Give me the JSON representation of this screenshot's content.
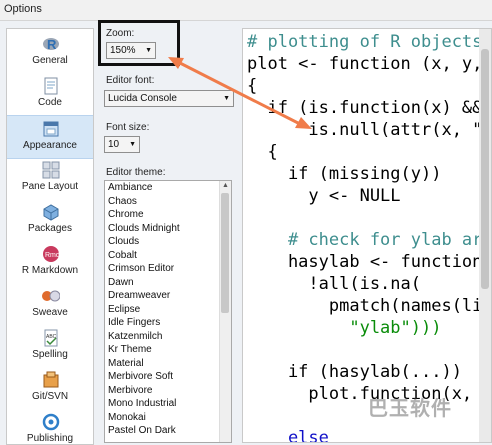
{
  "window": {
    "title": "Options"
  },
  "sidebar": {
    "items": [
      {
        "label": "General",
        "icon": "r-logo-icon",
        "selected": false
      },
      {
        "label": "Code",
        "icon": "code-document-icon",
        "selected": false
      },
      {
        "label": "Appearance",
        "icon": "appearance-icon",
        "selected": true
      },
      {
        "label": "Pane Layout",
        "icon": "pane-layout-icon",
        "selected": false
      },
      {
        "label": "Packages",
        "icon": "packages-icon",
        "selected": false
      },
      {
        "label": "R Markdown",
        "icon": "rmarkdown-icon",
        "selected": false
      },
      {
        "label": "Sweave",
        "icon": "sweave-icon",
        "selected": false
      },
      {
        "label": "Spelling",
        "icon": "spelling-icon",
        "selected": false
      },
      {
        "label": "Git/SVN",
        "icon": "git-svn-icon",
        "selected": false
      },
      {
        "label": "Publishing",
        "icon": "publishing-icon",
        "selected": false
      }
    ]
  },
  "appearance": {
    "zoom_label": "Zoom:",
    "zoom_value": "150%",
    "editor_font_label": "Editor font:",
    "editor_font_value": "Lucida Console",
    "font_size_label": "Font size:",
    "font_size_value": "10",
    "editor_theme_label": "Editor theme:",
    "themes": [
      "Ambiance",
      "Chaos",
      "Chrome",
      "Clouds Midnight",
      "Clouds",
      "Cobalt",
      "Crimson Editor",
      "Dawn",
      "Dreamweaver",
      "Eclipse",
      "Idle Fingers",
      "Katzenmilch",
      "Kr Theme",
      "Material",
      "Merbivore Soft",
      "Merbivore",
      "Mono Industrial",
      "Monokai",
      "Pastel On Dark"
    ]
  },
  "preview": {
    "lines": [
      "# plotting of R objects",
      "plot <- function (x, y, ...)",
      "{",
      "  if (is.function(x) &&",
      "      is.null(attr(x, \"class\")))",
      "  {",
      "    if (missing(y))",
      "      y <- NULL",
      "",
      "    # check for ylab argument",
      "    hasylab <- function(...)",
      "      !all(is.na(",
      "        pmatch(names(list(...)),",
      "          \"ylab\")))",
      "",
      "    if (hasylab(...))",
      "      plot.function(x, y, ...)",
      "",
      "    else"
    ]
  },
  "colors": {
    "annotation_arrow": "#f07c4a",
    "comment": "#3e8e8e",
    "keyword": "#1010c8",
    "string": "#098c09"
  },
  "watermark": "巴玉软件"
}
